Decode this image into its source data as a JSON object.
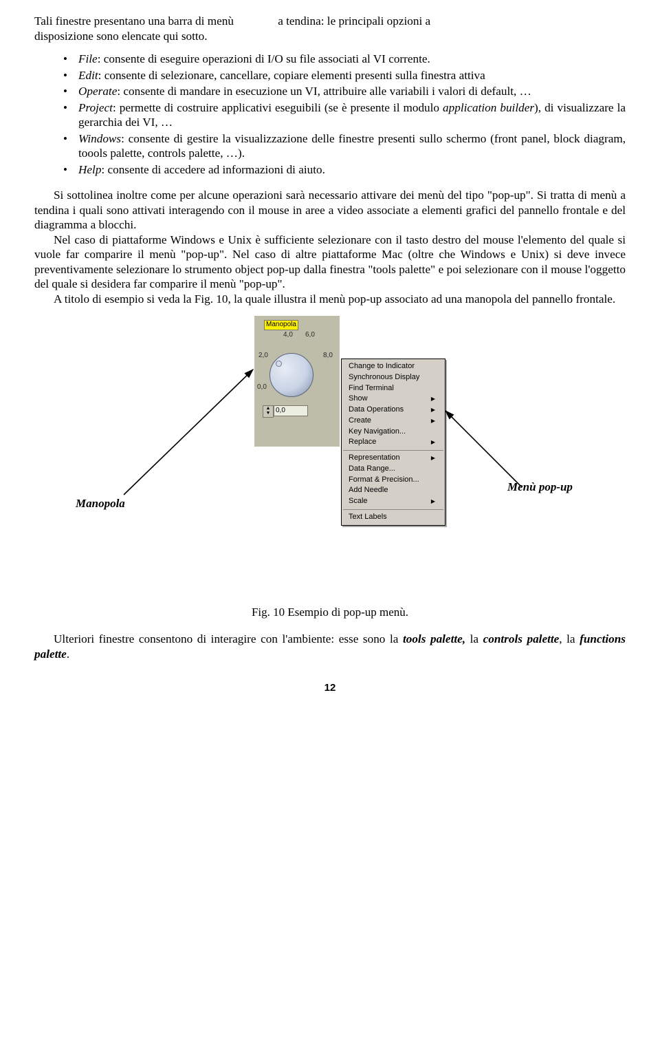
{
  "intro_part_a": "Tali finestre presentano una barra di menù ",
  "intro_part_b": "a tendina: le principali opzioni a",
  "intro_line2": "disposizione sono elencate qui sotto.",
  "bullets": [
    {
      "term": "File",
      "rest": ": consente di eseguire operazioni di I/O su file associati al VI corrente."
    },
    {
      "term": "Edit",
      "rest": ": consente di selezionare, cancellare, copiare elementi presenti sulla finestra attiva"
    },
    {
      "term": "Operate",
      "rest": ": consente di mandare in esecuzione un VI, attribuire alle variabili i valori di default, …"
    },
    {
      "term": "Project",
      "rest": ": permette di costruire applicativi eseguibili (se è presente il modulo ",
      "it2": "application builder",
      "rest2": "), di visualizzare la gerarchia dei VI, …"
    },
    {
      "term": "Windows",
      "rest": ": consente di gestire la visualizzazione delle finestre presenti sullo schermo (front panel, block diagram, toools palette, controls palette, …)."
    },
    {
      "term": "Help",
      "rest": ": consente di accedere ad informazioni di aiuto."
    }
  ],
  "p2": "Si sottolinea inoltre come per alcune operazioni sarà necessario attivare dei menù del tipo \"pop-up\". Si tratta di menù a tendina i quali sono attivati interagendo con il mouse in aree a video associate a elementi grafici del pannello frontale e del diagramma a blocchi.",
  "p3": "Nel caso di piattaforme Windows e Unix è sufficiente selezionare con il tasto destro del mouse l'elemento del quale si vuole far comparire il menù \"pop-up\". Nel caso di altre piattaforme Mac (oltre che Windows e Unix) si deve invece preventivamente selezionare lo strumento object pop-up dalla finestra \"tools palette\" e poi selezionare con il mouse l'oggetto del quale si desidera far comparire il menù \"pop-up\".",
  "p4": "A titolo di esempio si veda la  Fig. 10, la quale illustra il menù pop-up associato ad una manopola del pannello frontale.",
  "knob_label": "Manopola",
  "knob_ticks": {
    "t0": "0,0",
    "t2": "2,0",
    "t4": "4,0",
    "t6": "6,0",
    "t8": "8,0"
  },
  "knob_value": "0,0",
  "popup_items_a": [
    {
      "label": "Change to Indicator",
      "sub": false
    },
    {
      "label": "Synchronous Display",
      "sub": false
    },
    {
      "label": "Find Terminal",
      "sub": false
    },
    {
      "label": "Show",
      "sub": true
    },
    {
      "label": "Data Operations",
      "sub": true
    },
    {
      "label": "Create",
      "sub": true
    },
    {
      "label": "Key Navigation...",
      "sub": false
    },
    {
      "label": "Replace",
      "sub": true
    }
  ],
  "popup_items_b": [
    {
      "label": "Representation",
      "sub": true
    },
    {
      "label": "Data Range...",
      "sub": false
    },
    {
      "label": "Format & Precision...",
      "sub": false
    },
    {
      "label": "Add Needle",
      "sub": false
    },
    {
      "label": "Scale",
      "sub": true
    }
  ],
  "popup_items_c": [
    {
      "label": "Text Labels",
      "sub": false
    }
  ],
  "callout_left": "Manopola",
  "callout_right": "Menù pop-up",
  "fig_caption": "Fig. 10  Esempio di pop-up menù.",
  "p5_a": "Ulteriori finestre consentono di interagire con l'ambiente: esse sono la ",
  "p5_b": "tools palette,",
  "p5_c": " la ",
  "p5_d": "controls palette",
  "p5_e": ", la ",
  "p5_f": "functions palette",
  "p5_g": ".",
  "page_number": "12"
}
